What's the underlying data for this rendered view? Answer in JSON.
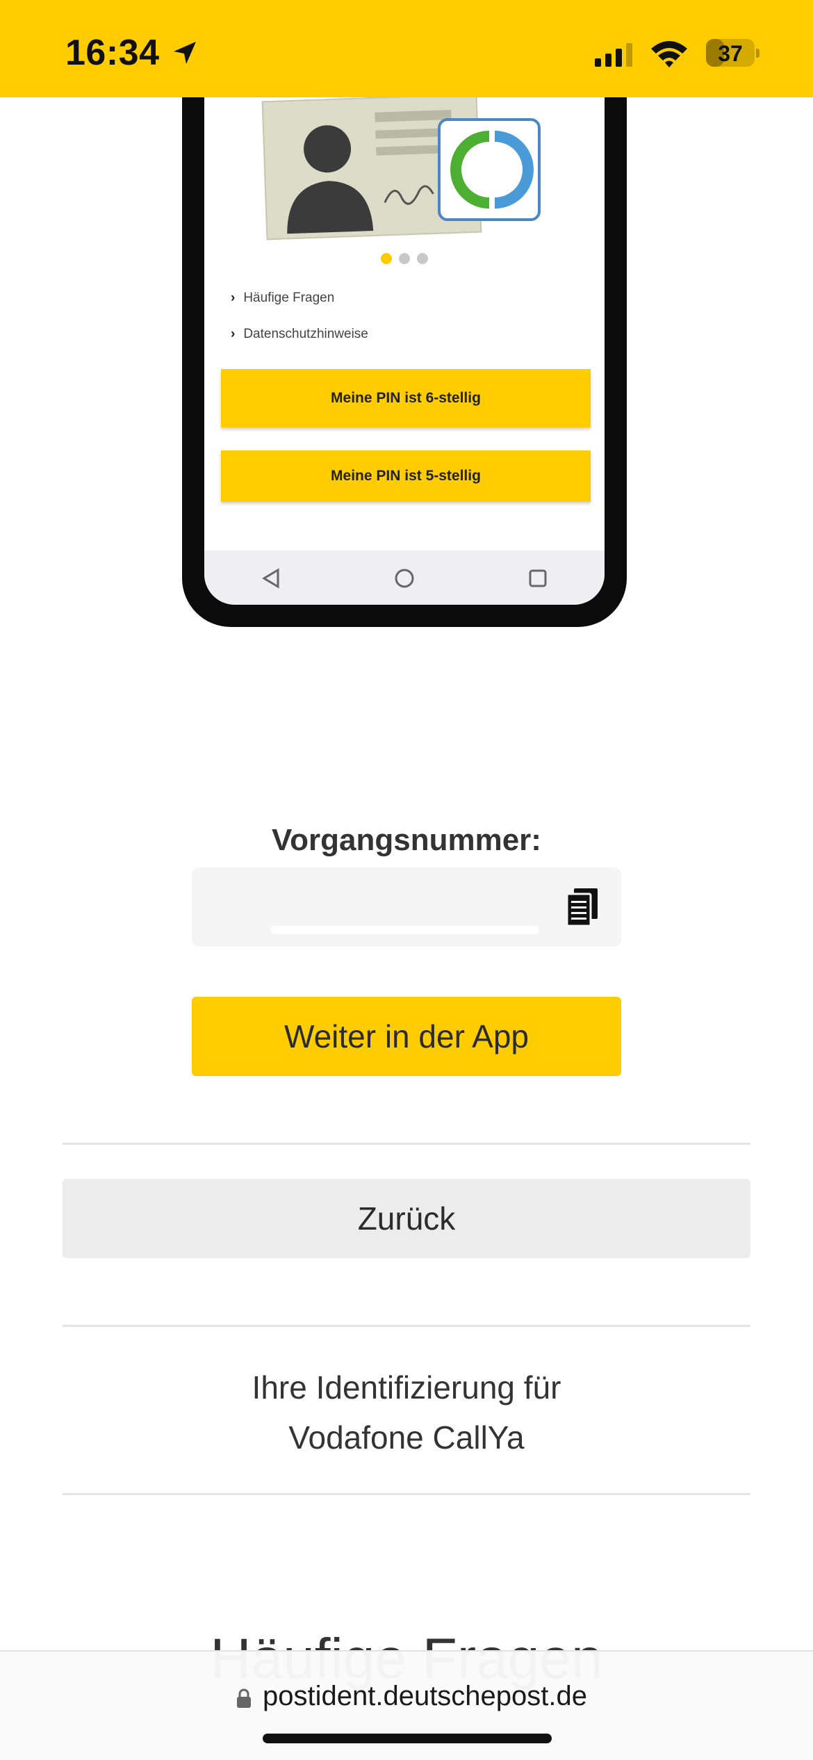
{
  "status_bar": {
    "time": "16:34",
    "battery_level": "37",
    "battery_fraction": 0.37,
    "background_color": "#FFCC00",
    "icons": [
      "location-arrow-icon",
      "cellular-signal-icon",
      "wifi-icon",
      "battery-icon"
    ]
  },
  "illustration": {
    "links": [
      "Häufige Fragen",
      "Datenschutzhinweise"
    ],
    "buttons": [
      "Meine PIN ist 6-stellig",
      "Meine PIN ist 5-stellig"
    ],
    "carousel": {
      "total": 3,
      "active_index": 0
    },
    "nav_icons": [
      "back-triangle-icon",
      "home-circle-icon",
      "recents-square-icon"
    ]
  },
  "vorgang": {
    "label": "Vorgangsnummer:",
    "value": "",
    "copy_icon": "copy-icon"
  },
  "actions": {
    "continue_label": "Weiter in der App",
    "back_label": "Zurück"
  },
  "identification": {
    "line1": "Ihre Identifizierung für",
    "line2": "Vodafone CallYa"
  },
  "faq": {
    "heading": "Häufige Fragen"
  },
  "browser": {
    "url": "postident.deutschepost.de",
    "lock_icon": "lock-icon"
  },
  "colors": {
    "accent": "#FFCC00",
    "secondary_button": "#ECECEC",
    "text": "#2B2B2B"
  }
}
